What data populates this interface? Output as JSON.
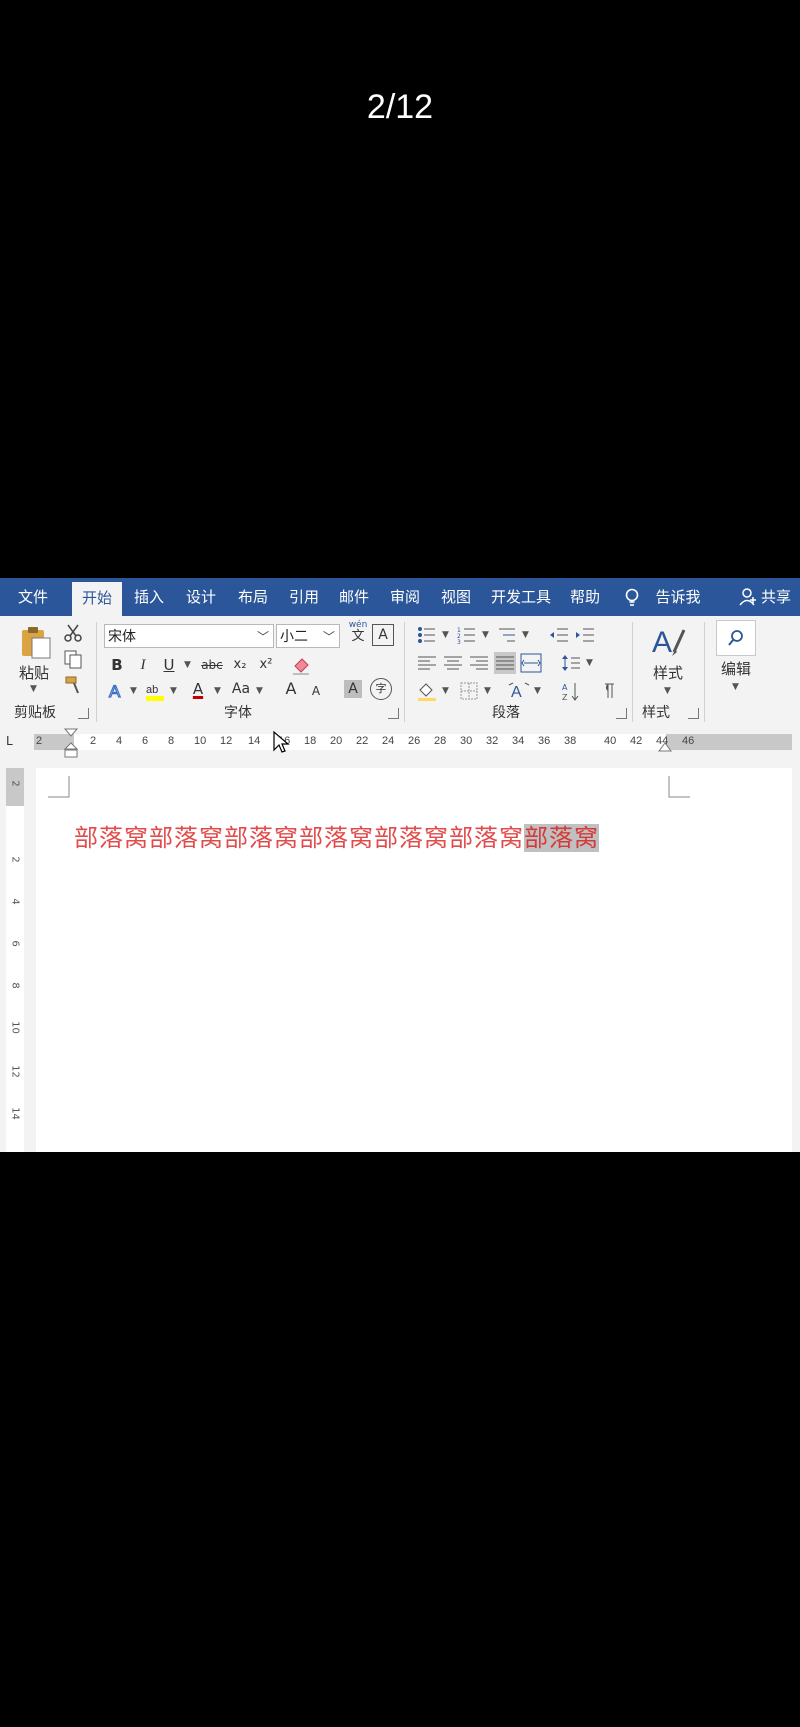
{
  "counter": "2/12",
  "tabs": [
    "文件",
    "开始",
    "插入",
    "设计",
    "布局",
    "引用",
    "邮件",
    "审阅",
    "视图",
    "开发工具",
    "帮助",
    "告诉我",
    "共享"
  ],
  "clipboard": {
    "paste_label": "粘贴",
    "group_label": "剪贴板"
  },
  "font": {
    "name": "宋体",
    "size": "小二",
    "phonetic": "wén",
    "phonetic_char": "文",
    "char_border": "A",
    "bold": "B",
    "italic": "I",
    "underline": "U",
    "strike": "abc",
    "subscript": "x₂",
    "superscript": "x²",
    "font_color": "A",
    "change_case": "Aa",
    "grow": "A",
    "shrink": "A",
    "shading": "A",
    "enclose": "字",
    "group_label": "字体"
  },
  "paragraph": {
    "group_label": "段落"
  },
  "styles": {
    "label": "样式",
    "group_label": "样式"
  },
  "editing": {
    "label": "编辑"
  },
  "ruler": {
    "corner": "L",
    "ticks": [
      "2",
      "2",
      "4",
      "6",
      "8",
      "10",
      "12",
      "14",
      "16",
      "18",
      "20",
      "22",
      "24",
      "26",
      "28",
      "30",
      "32",
      "34",
      "36",
      "38",
      "40",
      "42",
      "44",
      "46"
    ]
  },
  "vruler": {
    "ticks": [
      "2",
      "2",
      "4",
      "6",
      "8",
      "10",
      "12",
      "14"
    ]
  },
  "document": {
    "text_normal": "部落窝部落窝部落窝部落窝部落窝部落窝",
    "text_selected": "部落窝"
  },
  "colors": {
    "tab_bar": "#2b579a",
    "text": "#e24b4b",
    "selection": "#c0c0c0"
  }
}
